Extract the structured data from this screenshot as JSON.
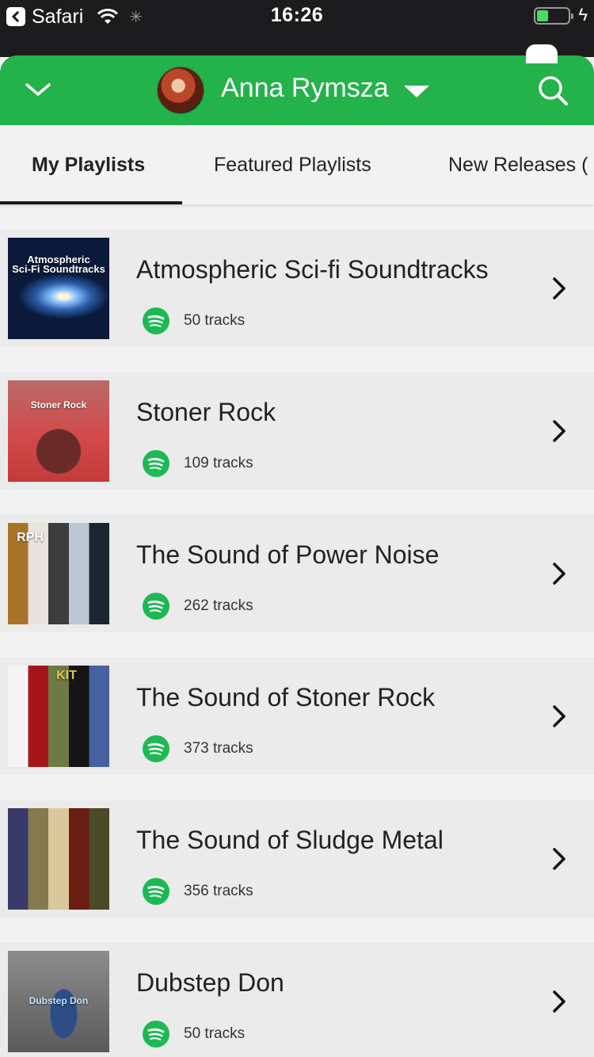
{
  "status_bar": {
    "back_app": "Safari",
    "time": "16:26"
  },
  "header": {
    "user_name": "Anna Rymsza"
  },
  "tabs": [
    {
      "label": "My Playlists",
      "active": true
    },
    {
      "label": "Featured Playlists",
      "active": false
    },
    {
      "label": "New Releases (",
      "active": false
    }
  ],
  "playlists": [
    {
      "title": "Atmospheric Sci-fi Soundtracks",
      "tracks": "50 tracks",
      "cover_text": "Atmospheric\nSci-Fi Soundtracks"
    },
    {
      "title": "Stoner Rock",
      "tracks": "109 tracks",
      "cover_text": "Stoner Rock"
    },
    {
      "title": "The Sound of Power Noise",
      "tracks": "262 tracks",
      "cover_text": "RPH"
    },
    {
      "title": "The Sound of Stoner Rock",
      "tracks": "373 tracks",
      "cover_text": "KIT"
    },
    {
      "title": "The Sound of Sludge Metal",
      "tracks": "356 tracks",
      "cover_text": ""
    },
    {
      "title": "Dubstep Don",
      "tracks": "50 tracks",
      "cover_text": "Dubstep Don"
    }
  ],
  "colors": {
    "header_green": "#24b24b",
    "spotify_green": "#1db954",
    "status_bar": "#1c1c1e",
    "battery_green": "#4cd964"
  },
  "icons": [
    "back-icon",
    "wifi-icon",
    "loading-spinner-icon",
    "battery-icon",
    "charging-bolt-icon",
    "chevron-down-icon",
    "caret-down-icon",
    "search-icon",
    "spotify-icon",
    "chevron-right-icon"
  ]
}
